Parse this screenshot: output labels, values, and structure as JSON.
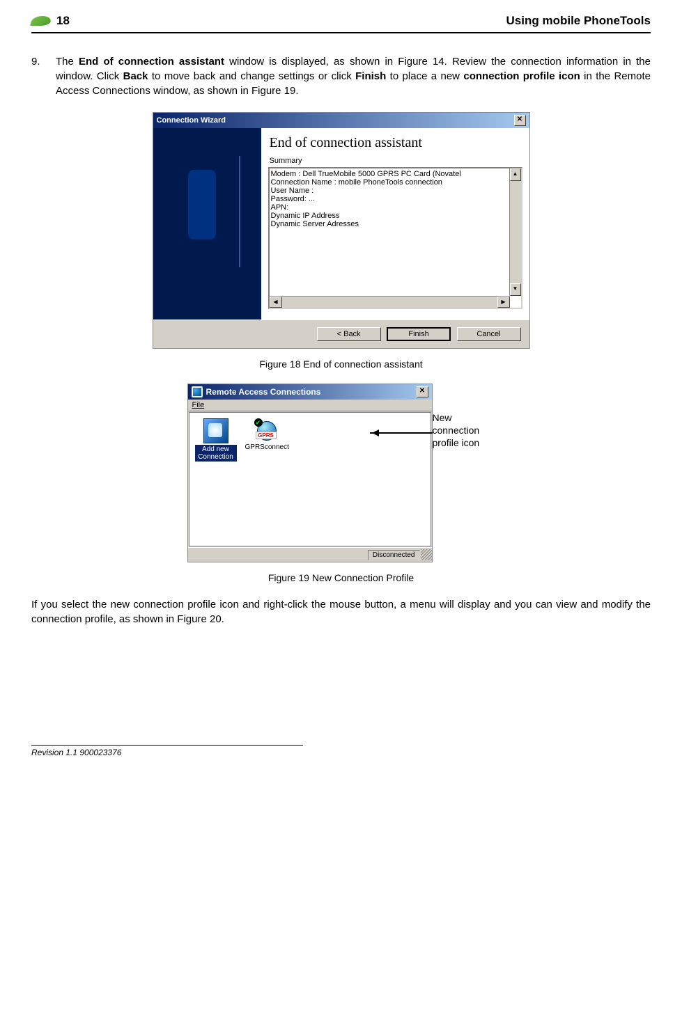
{
  "header": {
    "page_number": "18",
    "title": "Using mobile PhoneTools"
  },
  "step": {
    "num": "9.",
    "text_before_bold1": "The ",
    "bold1": "End of connection assistant",
    "text_mid1": " window is displayed, as shown in Figure 14. Review the connection information in the window. Click ",
    "bold2": "Back",
    "text_mid2": " to move back and change settings or click ",
    "bold3": "Finish",
    "text_mid3": " to place a new ",
    "bold4": "connection profile icon",
    "text_after": " in the Remote Access Connections window, as shown in Figure 19."
  },
  "fig18": {
    "window_title": "Connection Wizard",
    "heading": "End of connection assistant",
    "summary_label": "Summary",
    "lines": [
      "Modem : Dell TrueMobile 5000 GPRS PC Card (Novatel",
      "Connection Name : mobile PhoneTools connection",
      "User Name :",
      "Password: ...",
      "APN:",
      "Dynamic IP Address",
      "Dynamic Server Adresses"
    ],
    "buttons": {
      "back": "< Back",
      "finish": "Finish",
      "cancel": "Cancel"
    },
    "caption": "Figure 18 End of connection assistant"
  },
  "fig19": {
    "window_title": "Remote Access Connections",
    "menu_file": "File",
    "item_addnew": "Add new Connection",
    "item_gprs": "GPRSconnect",
    "gprs_band": "GPRS",
    "status": "Disconnected",
    "callout": "New connection profile icon",
    "caption": "Figure 19 New Connection Profile"
  },
  "para2": "If you select the new connection profile icon and right-click the mouse button, a menu will display and you can view and modify the connection profile, as shown in Figure 20.",
  "footer": "Revision 1.1 900023376"
}
